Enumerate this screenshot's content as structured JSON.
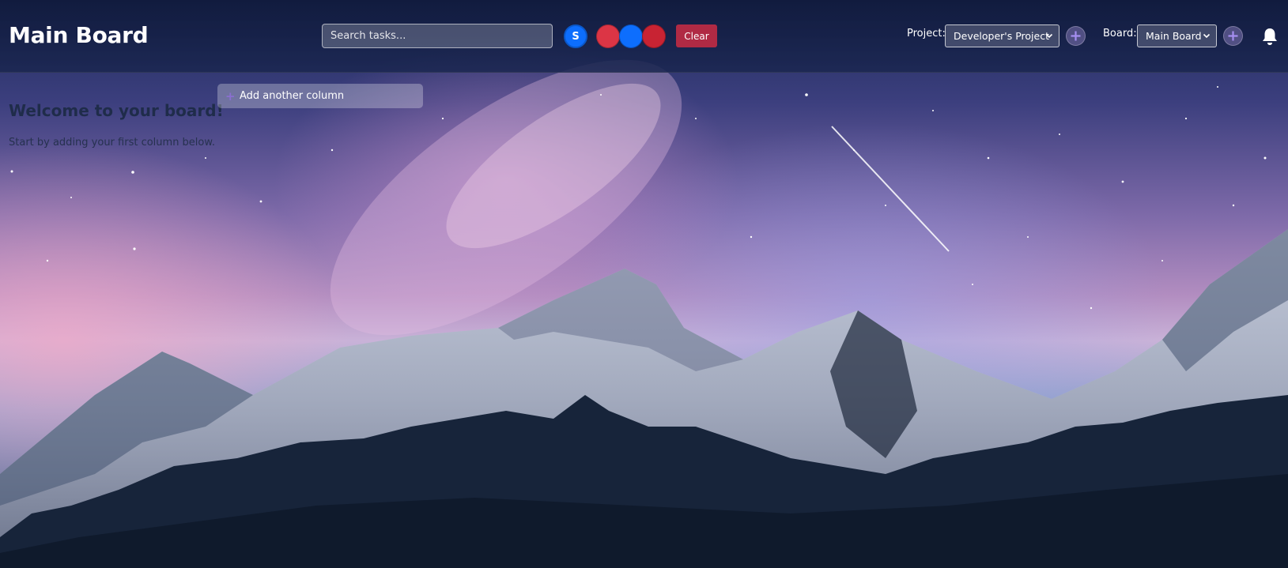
{
  "header": {
    "board_title": "Main Board",
    "search": {
      "placeholder": "Search tasks...",
      "value": ""
    },
    "user_avatar": {
      "initial": "S",
      "color": "#0d6efd"
    },
    "color_filters": [
      "#dc3545",
      "#0d6efd",
      "#c82333"
    ],
    "clear_label": "Clear",
    "project_label": "Project:",
    "project_selected": "Developer's Project",
    "board_label": "Board:",
    "board_selected": "Main Board",
    "icons": {
      "add_project": "plus-icon",
      "add_board": "plus-icon",
      "notifications": "bell-icon",
      "dropdown": "chevron-down-icon"
    }
  },
  "main": {
    "welcome_title": "Welcome to your board!",
    "welcome_text": "Start by adding your first column below.",
    "add_column_label": "Add another column"
  },
  "colors": {
    "accent_purple": "#8a6fd0",
    "clear_button": "#b02a44",
    "header_bg": "#16224a"
  }
}
